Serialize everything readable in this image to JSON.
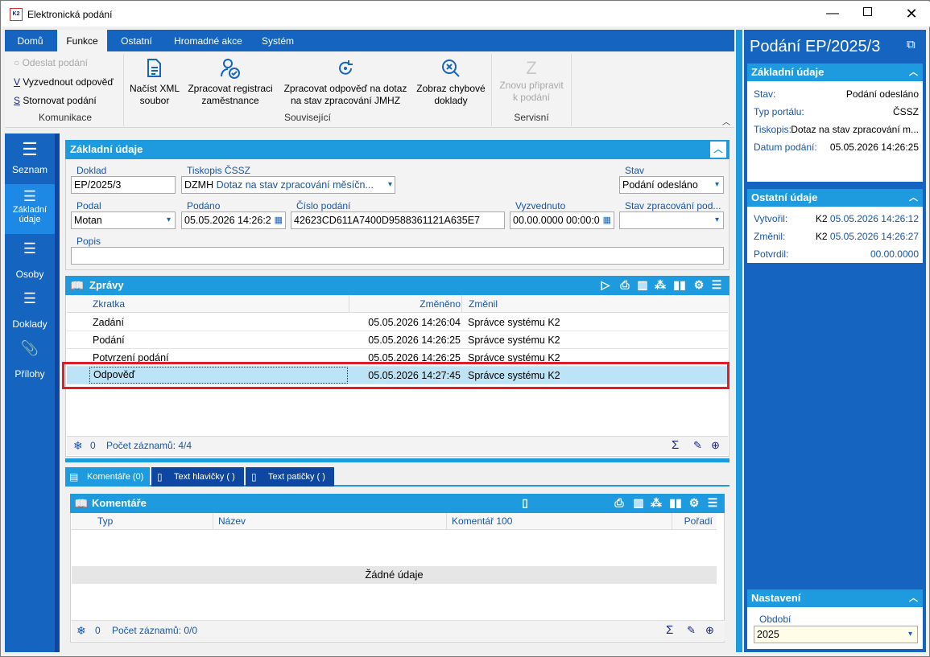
{
  "window": {
    "title": "Elektronická podání",
    "app_icon": "K2"
  },
  "ribbon": {
    "tabs": [
      "Domů",
      "Funkce",
      "Ostatní",
      "Hromadné akce",
      "Systém"
    ],
    "komunikace": {
      "odeslat": "Odeslat podání",
      "vyzvednout": "Vyzvednout odpověď",
      "stornovat": "Stornovat podání",
      "group": "Komunikace"
    },
    "souvisejici": {
      "nacist_1": "Načíst XML",
      "nacist_2": "soubor",
      "registrace_1": "Zpracovat registraci",
      "registrace_2": "zaměstnance",
      "odpoved_1": "Zpracovat odpověď na dotaz",
      "odpoved_2": "na stav zpracování JMHZ",
      "chyby_1": "Zobraz chybové",
      "chyby_2": "doklady",
      "group": "Související"
    },
    "servisni": {
      "znovu_1": "Znovu připravit",
      "znovu_2": "k podání",
      "group": "Servisní"
    }
  },
  "nav": {
    "seznam": "Seznam",
    "zakladni_1": "Základní",
    "zakladni_2": "údaje",
    "osoby": "Osoby",
    "doklady": "Doklady",
    "prilohy": "Přílohy"
  },
  "basic": {
    "header": "Základní údaje",
    "doklad_label": "Doklad",
    "doklad": "EP/2025/3",
    "tiskopis_label": "Tiskopis ČSSZ",
    "tiskopis_code": "DZMH",
    "tiskopis_name": "Dotaz na stav zpracování měsíčn...",
    "stav_label": "Stav",
    "stav": "Podání odesláno",
    "podal_label": "Podal",
    "podal": "Motan",
    "podano_label": "Podáno",
    "podano": "05.05.2026 14:26:2",
    "cislo_label": "Číslo podání",
    "cislo": "42623CD611A7400D9588361121A635E7",
    "vyzvednuto_label": "Vyzvednuto",
    "vyzvednuto": "00.00.0000 00:00:0",
    "stav_zprac_label": "Stav zpracování pod...",
    "stav_zprac": "",
    "popis_label": "Popis",
    "popis": ""
  },
  "zpravy": {
    "header": "Zprávy",
    "columns": [
      "Zkratka",
      "Změněno",
      "Změnil"
    ],
    "rows": [
      {
        "zkratka": "Zadání",
        "zmeneno": "05.05.2026 14:26:04",
        "zmenil": "Správce systému K2"
      },
      {
        "zkratka": "Podání",
        "zmeneno": "05.05.2026 14:26:25",
        "zmenil": "Správce systému K2"
      },
      {
        "zkratka": "Potvrzení podání",
        "zmeneno": "05.05.2026 14:26:25",
        "zmenil": "Správce systému K2"
      },
      {
        "zkratka": "Odpověď",
        "zmeneno": "05.05.2026 14:27:45",
        "zmenil": "Správce systému K2"
      }
    ],
    "footer_count": "0",
    "footer_records": "Počet záznamů: 4/4"
  },
  "bottom_tabs": [
    "Komentáře (0)",
    "Text hlavičky ( )",
    "Text patičky ( )"
  ],
  "komentare": {
    "header": "Komentáře",
    "columns": [
      "Typ",
      "Název",
      "Komentář 100",
      "Pořadí"
    ],
    "empty": "Žádné údaje",
    "footer_count": "0",
    "footer_records": "Počet záznamů: 0/0"
  },
  "right": {
    "title": "Podání EP/2025/3",
    "zakladni": {
      "header": "Základní údaje",
      "stav_l": "Stav:",
      "stav": "Podání odesláno",
      "portal_l": "Typ portálu:",
      "portal": "ČSSZ",
      "tiskopis_l": "Tiskopis:",
      "tiskopis": "Dotaz na stav zpracování m...",
      "datum_l": "Datum podání:",
      "datum": "05.05.2026 14:26:25"
    },
    "ostatni": {
      "header": "Ostatní údaje",
      "vytvoril_l": "Vytvořil:",
      "vytvoril_u": "K2",
      "vytvoril_d": "05.05.2026 14:26:12",
      "zmenil_l": "Změnil:",
      "zmenil_u": "K2",
      "zmenil_d": "05.05.2026 14:26:27",
      "potvrdil_l": "Potvrdil:",
      "potvrdil_d": "00.00.0000"
    },
    "nastaveni": {
      "header": "Nastavení",
      "obdobi_l": "Období",
      "obdobi": "2025"
    }
  },
  "colors": {
    "ribbon_blue": "#1565c0",
    "panel_header": "#1e9bdf",
    "selection": "#bde3f7",
    "highlight_border": "#e11d2a"
  }
}
